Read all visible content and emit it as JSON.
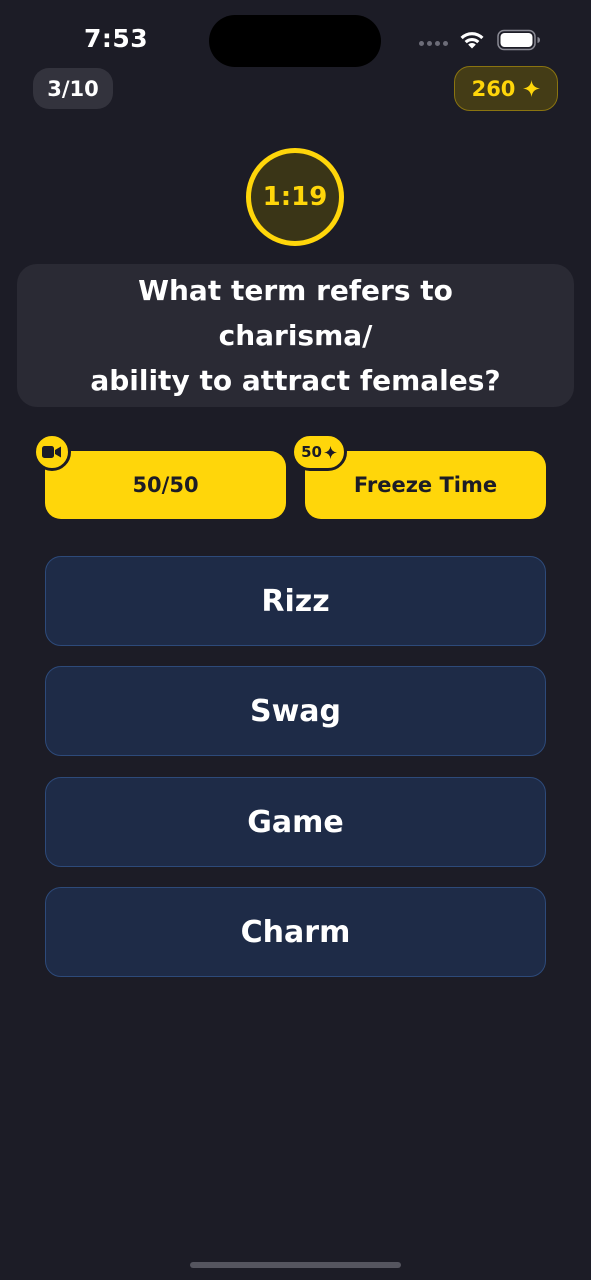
{
  "status_bar": {
    "time": "7:53"
  },
  "header": {
    "progress": "3/10",
    "coins": "260"
  },
  "timer": {
    "value": "1:19"
  },
  "question": {
    "line1": "What term refers to charisma/",
    "line2": "ability to attract females?"
  },
  "lifelines": {
    "fifty_fifty_label": "50/50",
    "freeze_label": "Freeze Time",
    "freeze_cost": "50"
  },
  "answers": [
    {
      "label": "Rizz"
    },
    {
      "label": "Swag"
    },
    {
      "label": "Game"
    },
    {
      "label": "Charm"
    }
  ],
  "colors": {
    "background": "#1c1c26",
    "accent": "#ffd60a",
    "answer_bg": "#1e2b47",
    "answer_border": "#2d4a7a",
    "card_bg": "#2a2a34"
  }
}
